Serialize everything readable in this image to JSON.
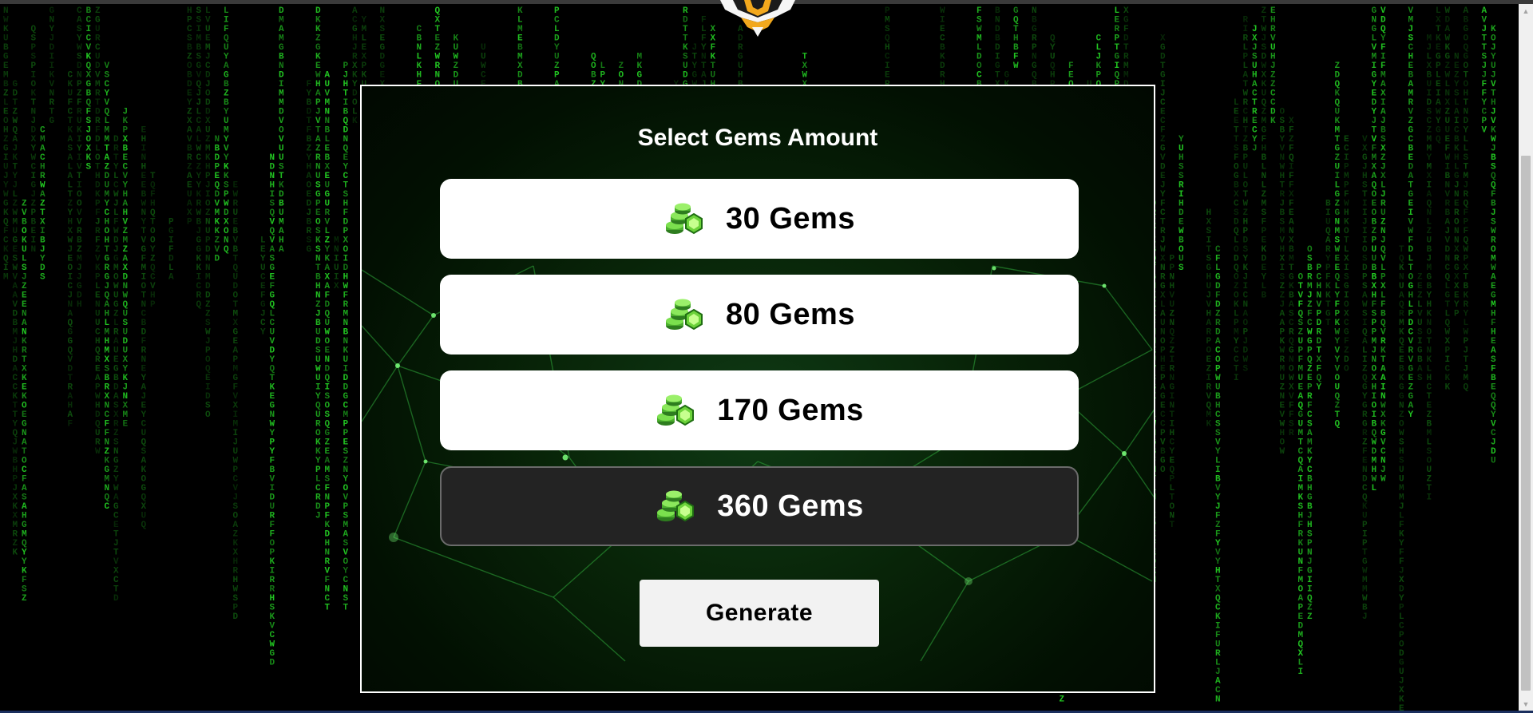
{
  "panel": {
    "title": "Select Gems Amount"
  },
  "options": [
    {
      "label": "30 Gems",
      "icon": "gem-pile-icon",
      "selected": false
    },
    {
      "label": "80 Gems",
      "icon": "gem-pile-icon",
      "selected": false
    },
    {
      "label": "170 Gems",
      "icon": "gem-pile-icon",
      "selected": false
    },
    {
      "label": "360 Gems",
      "icon": "gem-pile-icon",
      "selected": true
    }
  ],
  "generate_label": "Generate",
  "colors": {
    "background": "#000000",
    "matrix_green": "#22c822",
    "option_bg": "#ffffff",
    "option_selected_bg": "#232323",
    "gem_green": "#5fd33a"
  },
  "scrollbar": {
    "up_icon": "scroll-up-arrow-icon",
    "down_icon": "scroll-down-arrow-icon"
  }
}
